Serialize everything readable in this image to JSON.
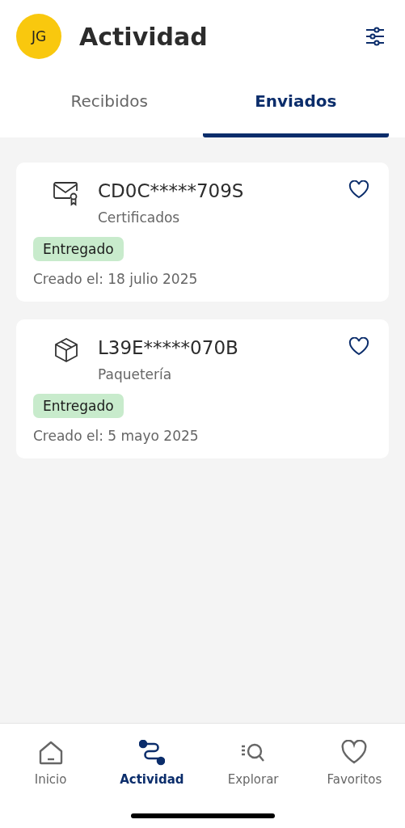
{
  "header": {
    "avatar": "JG",
    "title": "Actividad"
  },
  "tabs": [
    {
      "label": "Recibidos",
      "selected": false
    },
    {
      "label": "Enviados",
      "selected": true
    }
  ],
  "shipments": [
    {
      "kind": "certificate",
      "code": "CD0C*****709S",
      "category": "Certificados",
      "status": "Entregado",
      "created": "Creado el: 18 julio 2025"
    },
    {
      "kind": "package",
      "code": "L39E*****070B",
      "category": "Paquetería",
      "status": "Entregado",
      "created": "Creado el: 5 mayo 2025"
    }
  ],
  "nav": [
    {
      "kind": "home",
      "label": "Inicio",
      "selected": false
    },
    {
      "kind": "activity",
      "label": "Actividad",
      "selected": true
    },
    {
      "kind": "explore",
      "label": "Explorar",
      "selected": false
    },
    {
      "kind": "favorites",
      "label": "Favoritos",
      "selected": false
    }
  ]
}
